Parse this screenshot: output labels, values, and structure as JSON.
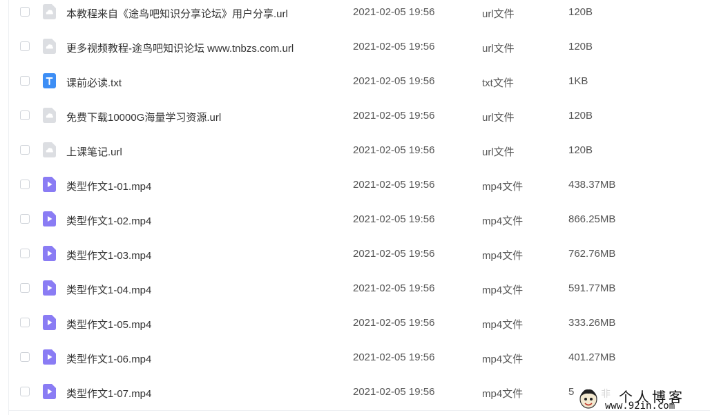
{
  "files": [
    {
      "name": "本教程来自《途鸟吧知识分享论坛》用户分享.url",
      "date": "2021-02-05 19:56",
      "type": "url文件",
      "size": "120B",
      "icon": "url-file-icon"
    },
    {
      "name": "更多视频教程-途鸟吧知识论坛 www.tnbzs.com.url",
      "date": "2021-02-05 19:56",
      "type": "url文件",
      "size": "120B",
      "icon": "url-file-icon"
    },
    {
      "name": "课前必读.txt",
      "date": "2021-02-05 19:56",
      "type": "txt文件",
      "size": "1KB",
      "icon": "txt-file-icon"
    },
    {
      "name": "免费下载10000G海量学习资源.url",
      "date": "2021-02-05 19:56",
      "type": "url文件",
      "size": "120B",
      "icon": "url-file-icon"
    },
    {
      "name": "上课笔记.url",
      "date": "2021-02-05 19:56",
      "type": "url文件",
      "size": "120B",
      "icon": "url-file-icon"
    },
    {
      "name": "类型作文1-01.mp4",
      "date": "2021-02-05 19:56",
      "type": "mp4文件",
      "size": "438.37MB",
      "icon": "video-file-icon"
    },
    {
      "name": "类型作文1-02.mp4",
      "date": "2021-02-05 19:56",
      "type": "mp4文件",
      "size": "866.25MB",
      "icon": "video-file-icon"
    },
    {
      "name": "类型作文1-03.mp4",
      "date": "2021-02-05 19:56",
      "type": "mp4文件",
      "size": "762.76MB",
      "icon": "video-file-icon"
    },
    {
      "name": "类型作文1-04.mp4",
      "date": "2021-02-05 19:56",
      "type": "mp4文件",
      "size": "591.77MB",
      "icon": "video-file-icon"
    },
    {
      "name": "类型作文1-05.mp4",
      "date": "2021-02-05 19:56",
      "type": "mp4文件",
      "size": "333.26MB",
      "icon": "video-file-icon"
    },
    {
      "name": "类型作文1-06.mp4",
      "date": "2021-02-05 19:56",
      "type": "mp4文件",
      "size": "401.27MB",
      "icon": "video-file-icon"
    },
    {
      "name": "类型作文1-07.mp4",
      "date": "2021-02-05 19:56",
      "type": "mp4文件",
      "size": "5",
      "icon": "video-file-icon"
    }
  ],
  "watermark": {
    "title": "个人博客",
    "url": "www.92in.com"
  },
  "colors": {
    "url_icon": "#dcdee2",
    "txt_icon": "#3d8ef5",
    "video_icon": "#8a7cf4",
    "text": "#333333",
    "muted_text": "#555555"
  }
}
